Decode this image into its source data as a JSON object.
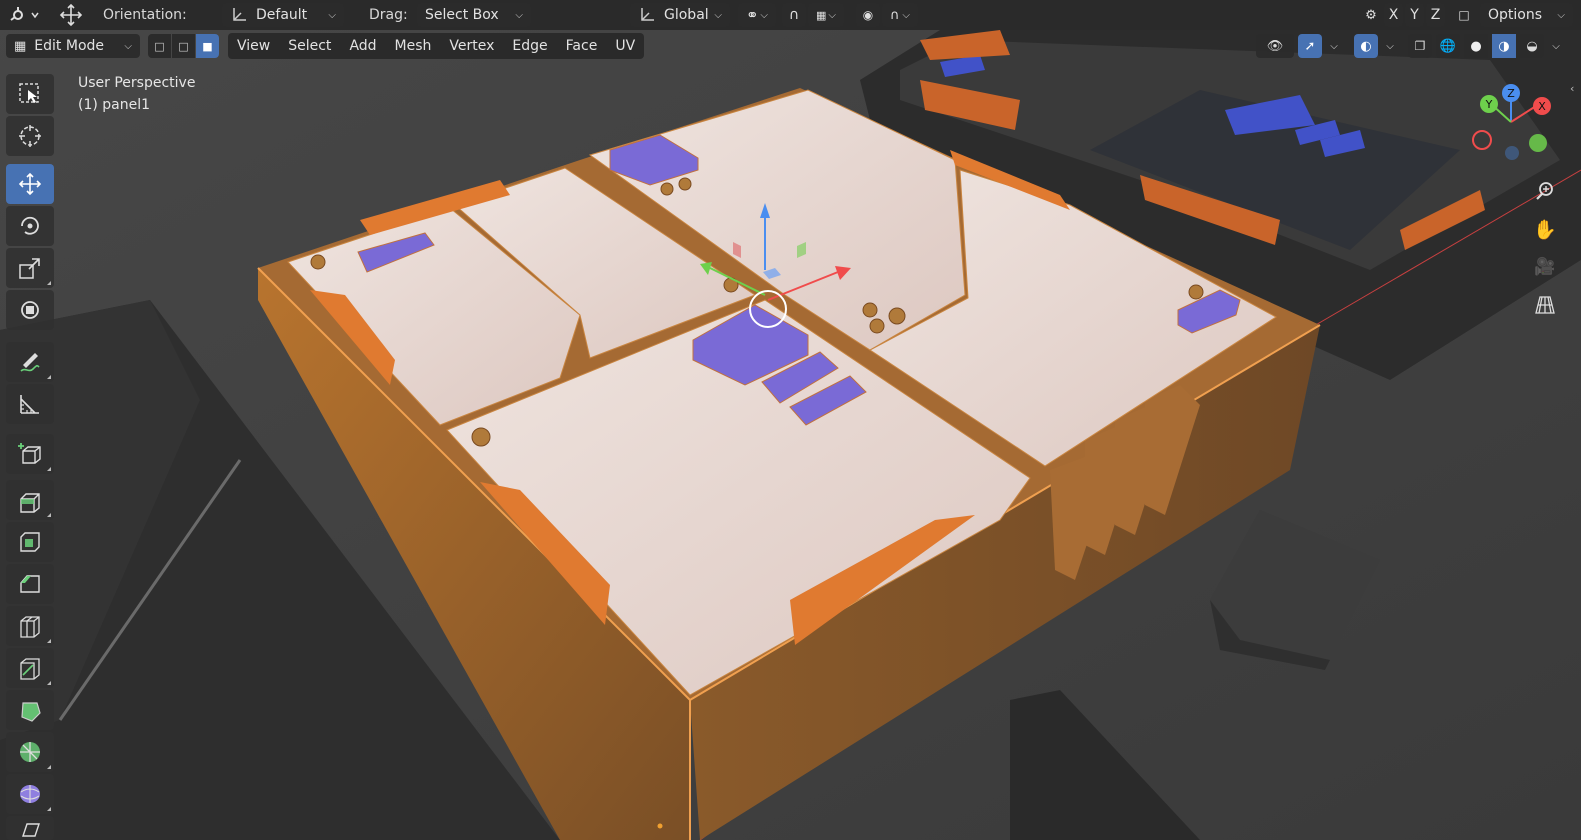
{
  "header": {
    "orientation_label": "Orientation:",
    "orientation_value": "Default",
    "drag_label": "Drag:",
    "drag_value": "Select Box",
    "transform_space": "Global",
    "axis_x": "X",
    "axis_y": "Y",
    "axis_z": "Z",
    "options_label": "Options"
  },
  "mode_bar": {
    "mode": "Edit Mode",
    "menus": [
      "View",
      "Select",
      "Add",
      "Mesh",
      "Vertex",
      "Edge",
      "Face",
      "UV"
    ]
  },
  "viewport": {
    "perspective_label": "User Perspective",
    "object_label": "(1) panel1"
  },
  "gizmo": {
    "x": "X",
    "y": "Y",
    "z": "Z"
  },
  "colors": {
    "selection_orange": "#e8873a",
    "face_select_blue": "#4772b3",
    "panel_face": "#e6d6cf",
    "button_purple": "#7a6ad6"
  },
  "icons": {
    "left_toolbar": [
      "select-box-icon",
      "cursor-icon",
      "move-icon",
      "rotate-icon",
      "scale-icon",
      "transform-icon",
      "annotate-icon",
      "measure-icon",
      "add-cube-icon",
      "extrude-icon",
      "inset-icon",
      "bevel-icon",
      "loop-cut-icon",
      "knife-icon",
      "poly-build-icon",
      "spin-icon",
      "smooth-icon",
      "shear-icon"
    ],
    "right_nav": [
      "zoom-icon",
      "pan-hand-icon",
      "camera-icon",
      "grid-perspective-icon"
    ]
  }
}
